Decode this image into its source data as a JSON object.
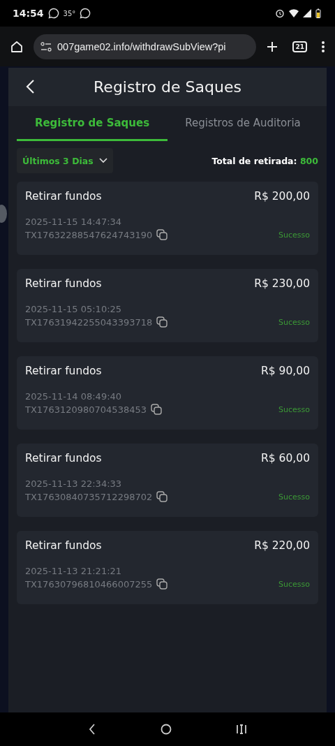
{
  "status_bar": {
    "time": "14:54",
    "temperature": "35°"
  },
  "browser": {
    "url": "007game02.info/withdrawSubView?pi",
    "tab_count": "21"
  },
  "header": {
    "title": "Registro de Saques"
  },
  "tabs": [
    {
      "label": "Registro de Saques",
      "selected": true
    },
    {
      "label": "Registros de Auditoria",
      "selected": false
    }
  ],
  "filter": {
    "label": "Últimos 3 Dias"
  },
  "total": {
    "label": "Total de retirada:",
    "value": "800"
  },
  "records": [
    {
      "title": "Retirar fundos",
      "amount": "R$ 200,00",
      "datetime": "2025-11-15 14:47:34",
      "transaction_id": "TX17632288547624743190",
      "status": "Sucesso"
    },
    {
      "title": "Retirar fundos",
      "amount": "R$ 230,00",
      "datetime": "2025-11-15 05:10:25",
      "transaction_id": "TX17631942255043393718",
      "status": "Sucesso"
    },
    {
      "title": "Retirar fundos",
      "amount": "R$ 90,00",
      "datetime": "2025-11-14 08:49:40",
      "transaction_id": "TX1763120980704538453",
      "status": "Sucesso"
    },
    {
      "title": "Retirar fundos",
      "amount": "R$ 60,00",
      "datetime": "2025-11-13 22:34:33",
      "transaction_id": "TX17630840735712298702",
      "status": "Sucesso"
    },
    {
      "title": "Retirar fundos",
      "amount": "R$ 220,00",
      "datetime": "2025-11-13 21:21:21",
      "transaction_id": "TX17630796810466007255",
      "status": "Sucesso"
    }
  ]
}
